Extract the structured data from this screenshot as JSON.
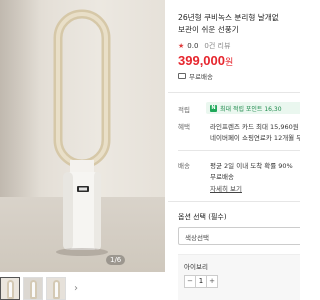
{
  "gallery": {
    "page_indicator": "1/6",
    "thumbnail_more": "›"
  },
  "product": {
    "title_line1": "26년형 쿠비녹스 분리형 날개없",
    "title_line2": "보관이 쉬운 선풍기",
    "rating": "0.0",
    "review_count": "0건 리뷰",
    "price": "399,000",
    "price_unit": "원",
    "free_shipping": "무료배송"
  },
  "benefits": {
    "point_label": "적립",
    "point_badge": "최대 적립 포인트 16,30",
    "benefit_label": "혜택",
    "benefit_line1": "라인프렌즈 카드 최대 15,960원 추",
    "benefit_line2": "네이버페이 쇼핑연료카 12개월 무",
    "delivery_label": "배송",
    "delivery_line1": "평균 2일 이내 도착 확률 90%",
    "delivery_line2": "무료배송",
    "detail_link": "자세히 보기"
  },
  "options": {
    "title": "옵션 선택 (필수)",
    "select_placeholder": "색상선택",
    "selected_option": "아이보리",
    "qty_minus": "−",
    "qty_value": "1",
    "qty_plus": "+"
  },
  "colors": {
    "price": "#e6262e",
    "point_green": "#1fa85a"
  }
}
